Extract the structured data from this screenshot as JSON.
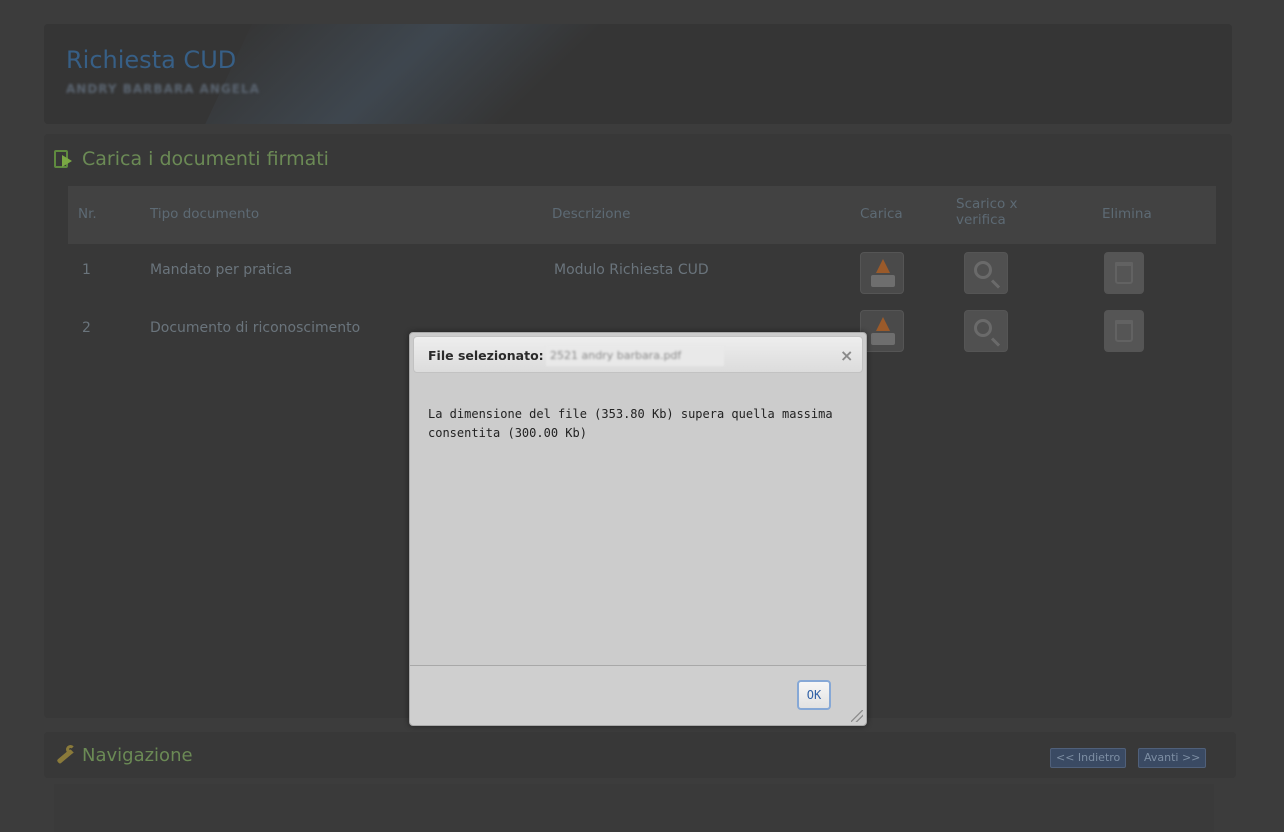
{
  "header": {
    "title": "Richiesta CUD",
    "subtitle": "ANDRY BARBARA ANGELA"
  },
  "documents": {
    "title": "Carica i documenti firmati",
    "columns": {
      "nr": "Nr.",
      "tipo": "Tipo documento",
      "descrizione": "Descrizione",
      "carica": "Carica",
      "scarico": "Scarico x verifica",
      "elimina": "Elimina"
    },
    "rows": [
      {
        "nr": "1",
        "tipo": "Mandato per pratica",
        "descrizione": "Modulo Richiesta CUD"
      },
      {
        "nr": "2",
        "tipo": "Documento di riconoscimento",
        "descrizione": ""
      }
    ]
  },
  "navigation": {
    "title": "Navigazione",
    "back_label": "<< Indietro",
    "next_label": "Avanti >>"
  },
  "modal": {
    "title_label": "File selezionato:",
    "file_name": "2521 andry barbara.pdf",
    "close_symbol": "×",
    "message": "La dimensione del file (353.80 Kb) supera quella massima consentita (300.00 Kb)",
    "ok_label": "OK"
  },
  "icons": {
    "section": "document-arrow-icon",
    "upload": "upload-icon",
    "search": "magnifier-icon",
    "trash": "trash-icon",
    "wrench": "wrench-icon"
  },
  "colors": {
    "overlay_background": "#3c3c3c",
    "header_title": "#375f86",
    "section_title": "#6b8a55",
    "modal_background": "#cccccc",
    "ok_border": "#86a8d6"
  }
}
